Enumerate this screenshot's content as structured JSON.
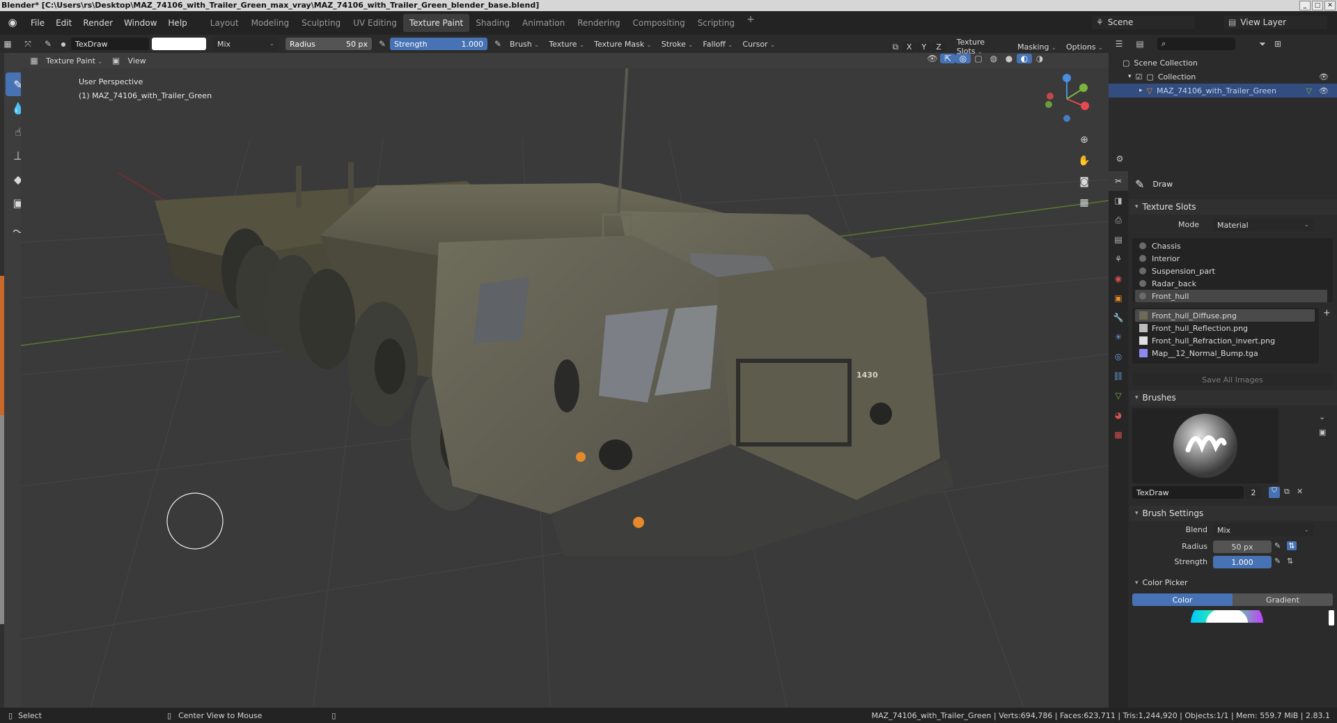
{
  "titlebar": {
    "title": "Blender* [C:\\Users\\rs\\Desktop\\MAZ_74106_with_Trailer_Green_max_vray\\MAZ_74106_with_Trailer_Green_blender_base.blend]"
  },
  "menubar": {
    "menus": [
      "File",
      "Edit",
      "Render",
      "Window",
      "Help"
    ],
    "workspaces": [
      "Layout",
      "Modeling",
      "Sculpting",
      "UV Editing",
      "Texture Paint",
      "Shading",
      "Animation",
      "Rendering",
      "Compositing",
      "Scripting"
    ],
    "active_workspace": "Texture Paint",
    "scene": "Scene",
    "view_layer": "View Layer"
  },
  "toolheader": {
    "brush_name": "TexDraw",
    "blend_mode": "Mix",
    "radius_label": "Radius",
    "radius_value": "50 px",
    "strength_label": "Strength",
    "strength_value": "1.000",
    "menus": [
      "Brush",
      "Texture",
      "Texture Mask",
      "Stroke",
      "Falloff",
      "Cursor"
    ],
    "axes": [
      "X",
      "Y",
      "Z"
    ],
    "right_menus": [
      "Texture Slots",
      "Masking",
      "Options"
    ]
  },
  "secondheader": {
    "mode": "Texture Paint",
    "view": "View"
  },
  "viewport": {
    "perspective": "User Perspective",
    "object": "(1) MAZ_74106_with_Trailer_Green",
    "vehicle_plate": "1430",
    "gizmo_colors": {
      "x": "#e8484e",
      "y": "#7ab53b",
      "z": "#4a8ee0"
    }
  },
  "outliner": {
    "scene_collection": "Scene Collection",
    "collection": "Collection",
    "object": "MAZ_74106_with_Trailer_Green"
  },
  "properties": {
    "tool_name": "Draw",
    "texture_slots_title": "Texture Slots",
    "mode_label": "Mode",
    "mode_value": "Material",
    "materials": [
      "Chassis",
      "Interior",
      "Suspension_part",
      "Radar_back",
      "Front_hull"
    ],
    "selected_material": "Front_hull",
    "images": [
      "Front_hull_Diffuse.png",
      "Front_hull_Reflection.png",
      "Front_hull_Refraction_invert.png",
      "Map__12_Normal_Bump.tga"
    ],
    "selected_image": "Front_hull_Diffuse.png",
    "save_all_images": "Save All Images",
    "brushes_title": "Brushes",
    "brush_name": "TexDraw",
    "brush_users": "2",
    "brush_settings_title": "Brush Settings",
    "blend_label": "Blend",
    "blend_value": "Mix",
    "radius_label": "Radius",
    "radius_value": "50 px",
    "strength_label": "Strength",
    "strength_value": "1.000",
    "color_picker_title": "Color Picker",
    "color_tab": "Color",
    "gradient_tab": "Gradient",
    "accent": "#4772b3"
  },
  "statusbar": {
    "select": "Select",
    "center_view": "Center View to Mouse",
    "stats": "MAZ_74106_with_Trailer_Green | Verts:694,786 | Faces:623,711 | Tris:1,244,920 | Objects:1/1 | Mem: 559.7 MiB | 2.83.1"
  }
}
